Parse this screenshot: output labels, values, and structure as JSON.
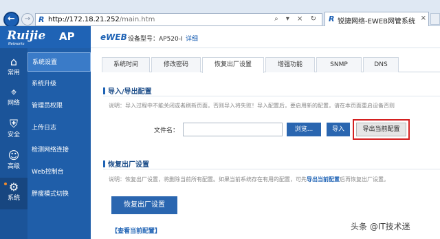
{
  "browser": {
    "url_host": "http://172.18.21.252",
    "url_path": "/main.htm",
    "addr_actions": "⌕ ▾ × ↻",
    "tab_title": "锐捷网络-EWEB网管系统",
    "back_glyph": "←",
    "forward_glyph": "→",
    "tab_icon": "R",
    "tab_close": "×"
  },
  "header": {
    "brand": "Ruijie",
    "brand_sub": "Networks",
    "brand_ap": "AP",
    "eweb": "eWEB",
    "model": "设备型号：AP520-I",
    "detail": "详细"
  },
  "sidebar": {
    "icons": [
      {
        "label": "常用",
        "glyph": "⌂",
        "icon": "home-icon"
      },
      {
        "label": "网络",
        "glyph": "⌖",
        "icon": "network-icon"
      },
      {
        "label": "安全",
        "glyph": "⛨",
        "icon": "shield-icon"
      },
      {
        "label": "高级",
        "glyph": "☺",
        "icon": "user-gear-icon"
      },
      {
        "label": "系统",
        "glyph": "⚙",
        "icon": "gear-icon"
      }
    ],
    "menu": [
      "系统设置",
      "系统升级",
      "管理员权限",
      "上传日志",
      "检测网络连接",
      "Web控制台",
      "胖瘦模式切换"
    ]
  },
  "tabs": [
    "系统时间",
    "修改密码",
    "恢复出厂设置",
    "增强功能",
    "SNMP",
    "DNS"
  ],
  "import_export": {
    "title": "导入/导出配置",
    "note": "说明：导入过程中不能关闭或者刷新页面，否则导入将失败！导入配置后，要启用新的配置，请在本页面重启设备否则",
    "file_label": "文件名：",
    "browse": "浏览...",
    "import": "导入",
    "export": "导出当前配置"
  },
  "restore": {
    "title": "恢复出厂设置",
    "note_before": "说明：恢复出厂设置，将删除当前所有配置。如果当前系统存在有用的配置，可先",
    "note_link": "导出当前配置",
    "note_after": "后再恢复出厂设置。",
    "button": "恢复出厂设置",
    "view_link": "【查看当前配置】"
  },
  "watermark": "头条 @IT技术迷"
}
